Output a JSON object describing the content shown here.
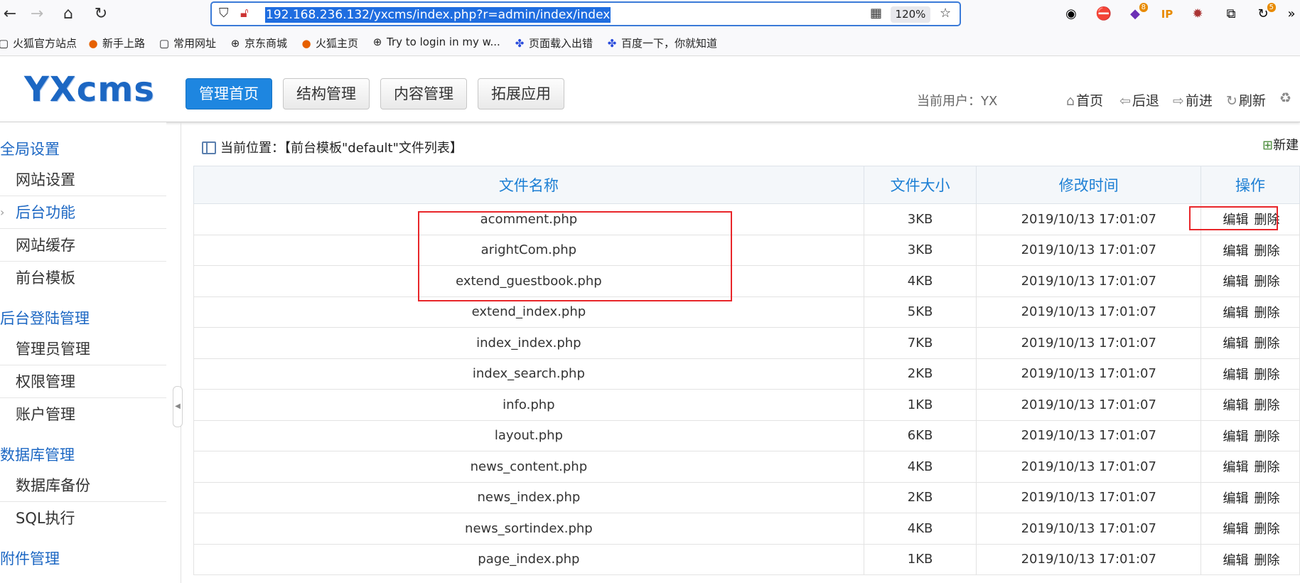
{
  "browser": {
    "url": "192.168.236.132/yxcms/index.php?r=admin/index/index",
    "zoom": "120%",
    "badges": {
      "ext_purple": "8",
      "ext_refresh": "5"
    },
    "ip_label": "IP",
    "bookmarks": [
      {
        "label": "火狐官方站点",
        "icon": "folder-icon"
      },
      {
        "label": "新手上路",
        "icon": "firefox-icon"
      },
      {
        "label": "常用网址",
        "icon": "folder-icon"
      },
      {
        "label": "京东商城",
        "icon": "globe-icon"
      },
      {
        "label": "火狐主页",
        "icon": "firefox-icon"
      },
      {
        "label": "Try to login in my w...",
        "icon": "globe-icon"
      },
      {
        "label": "页面载入出错",
        "icon": "paw-icon"
      },
      {
        "label": "百度一下，你就知道",
        "icon": "paw-icon"
      }
    ]
  },
  "header": {
    "logo": "YXcms",
    "tabs": [
      "管理首页",
      "结构管理",
      "内容管理",
      "拓展应用"
    ],
    "current_user": "当前用户：YX",
    "links": [
      "首页",
      "后退",
      "前进",
      "刷新"
    ]
  },
  "sidebar": {
    "groups": [
      {
        "title": "全局设置",
        "items": [
          "网站设置",
          "后台功能",
          "网站缓存",
          "前台模板"
        ]
      },
      {
        "title": "后台登陆管理",
        "items": [
          "管理员管理",
          "权限管理",
          "账户管理"
        ]
      },
      {
        "title": "数据库管理",
        "items": [
          "数据库备份",
          "SQL执行"
        ]
      },
      {
        "title": "附件管理",
        "items": []
      }
    ],
    "active_item": "后台功能"
  },
  "main": {
    "breadcrumb": "当前位置：【前台模板\"default\"文件列表】",
    "new_button": "新建",
    "columns": [
      "文件名称",
      "文件大小",
      "修改时间",
      "操作"
    ],
    "rows": [
      {
        "name": "acomment.php",
        "size": "3KB",
        "time": "2019/10/13 17:01:07"
      },
      {
        "name": "arightCom.php",
        "size": "3KB",
        "time": "2019/10/13 17:01:07"
      },
      {
        "name": "extend_guestbook.php",
        "size": "4KB",
        "time": "2019/10/13 17:01:07"
      },
      {
        "name": "extend_index.php",
        "size": "5KB",
        "time": "2019/10/13 17:01:07"
      },
      {
        "name": "index_index.php",
        "size": "7KB",
        "time": "2019/10/13 17:01:07"
      },
      {
        "name": "index_search.php",
        "size": "2KB",
        "time": "2019/10/13 17:01:07"
      },
      {
        "name": "info.php",
        "size": "1KB",
        "time": "2019/10/13 17:01:07"
      },
      {
        "name": "layout.php",
        "size": "6KB",
        "time": "2019/10/13 17:01:07"
      },
      {
        "name": "news_content.php",
        "size": "4KB",
        "time": "2019/10/13 17:01:07"
      },
      {
        "name": "news_index.php",
        "size": "2KB",
        "time": "2019/10/13 17:01:07"
      },
      {
        "name": "news_sortindex.php",
        "size": "4KB",
        "time": "2019/10/13 17:01:07"
      },
      {
        "name": "page_index.php",
        "size": "1KB",
        "time": "2019/10/13 17:01:07"
      }
    ],
    "ops": {
      "edit": "编辑",
      "delete": "删除"
    }
  },
  "colors": {
    "accent": "#1c67c3",
    "active_tab": "#1e86e0",
    "filename": "#1a8a1a",
    "highlight_box": "#e8262a"
  }
}
